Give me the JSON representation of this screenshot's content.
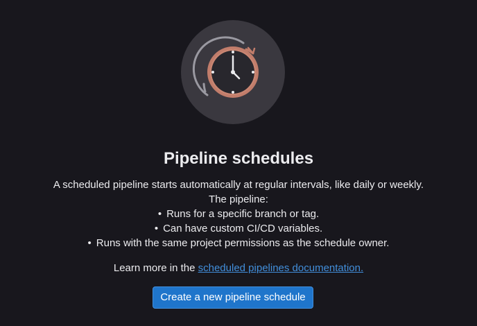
{
  "empty_state": {
    "illustration_icon": "clock-schedule-icon",
    "title": "Pipeline schedules",
    "description_line": "A scheduled pipeline starts automatically at regular intervals, like daily or weekly.",
    "list_intro": "The pipeline:",
    "bullet_char": "•",
    "bullets": [
      "Runs for a specific branch or tag.",
      "Can have custom CI/CD variables.",
      "Runs with the same project permissions as the schedule owner."
    ],
    "learn_more_prefix": "Learn more in the",
    "learn_more_link": "scheduled pipelines documentation.",
    "primary_button_label": "Create a new pipeline schedule"
  },
  "colors": {
    "background": "#18171d",
    "text": "#ececef",
    "link": "#428fdc",
    "button": "#1f75cb",
    "illustration_circle": "#3a383f",
    "clock_accent": "#c17d6b"
  }
}
